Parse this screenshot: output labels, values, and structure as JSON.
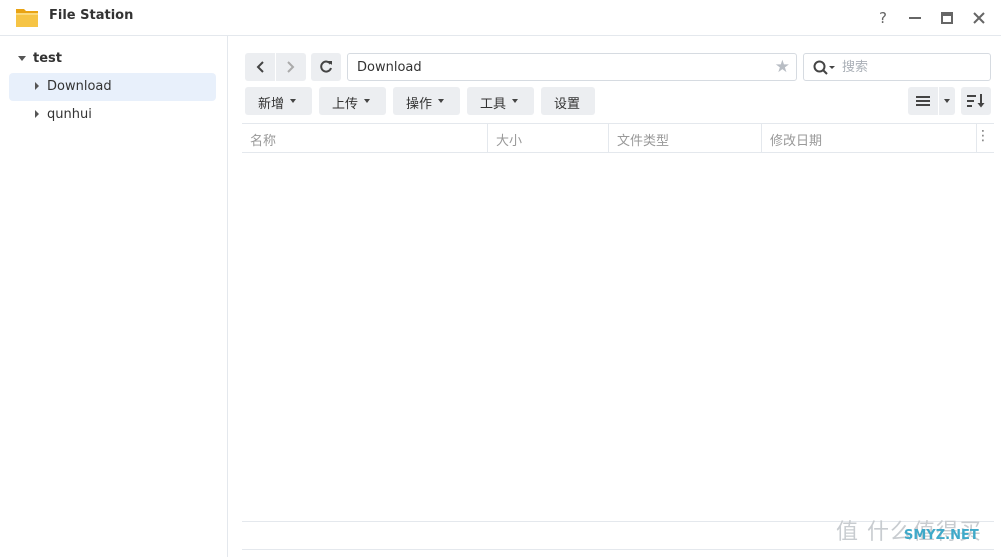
{
  "window": {
    "title": "File Station",
    "help_icon": "?",
    "minimize_icon": "—",
    "maximize_icon": "▭",
    "close_icon": "✕"
  },
  "sidebar": {
    "root_label": "test",
    "items": [
      {
        "label": "Download",
        "selected": true
      },
      {
        "label": "qunhui",
        "selected": false
      }
    ]
  },
  "toolbar": {
    "path": "Download",
    "search_placeholder": "搜索",
    "buttons": {
      "new": "新增",
      "upload": "上传",
      "action": "操作",
      "tools": "工具",
      "settings": "设置"
    }
  },
  "table": {
    "columns": [
      "名称",
      "大小",
      "文件类型",
      "修改日期"
    ],
    "rows": []
  },
  "watermark": {
    "text": "值 什么值得买",
    "site": "SMYZ.NET"
  },
  "colors": {
    "accent_bg": "#e8f0fb",
    "button_bg": "#eceef1",
    "border": "#e4e8ed"
  }
}
